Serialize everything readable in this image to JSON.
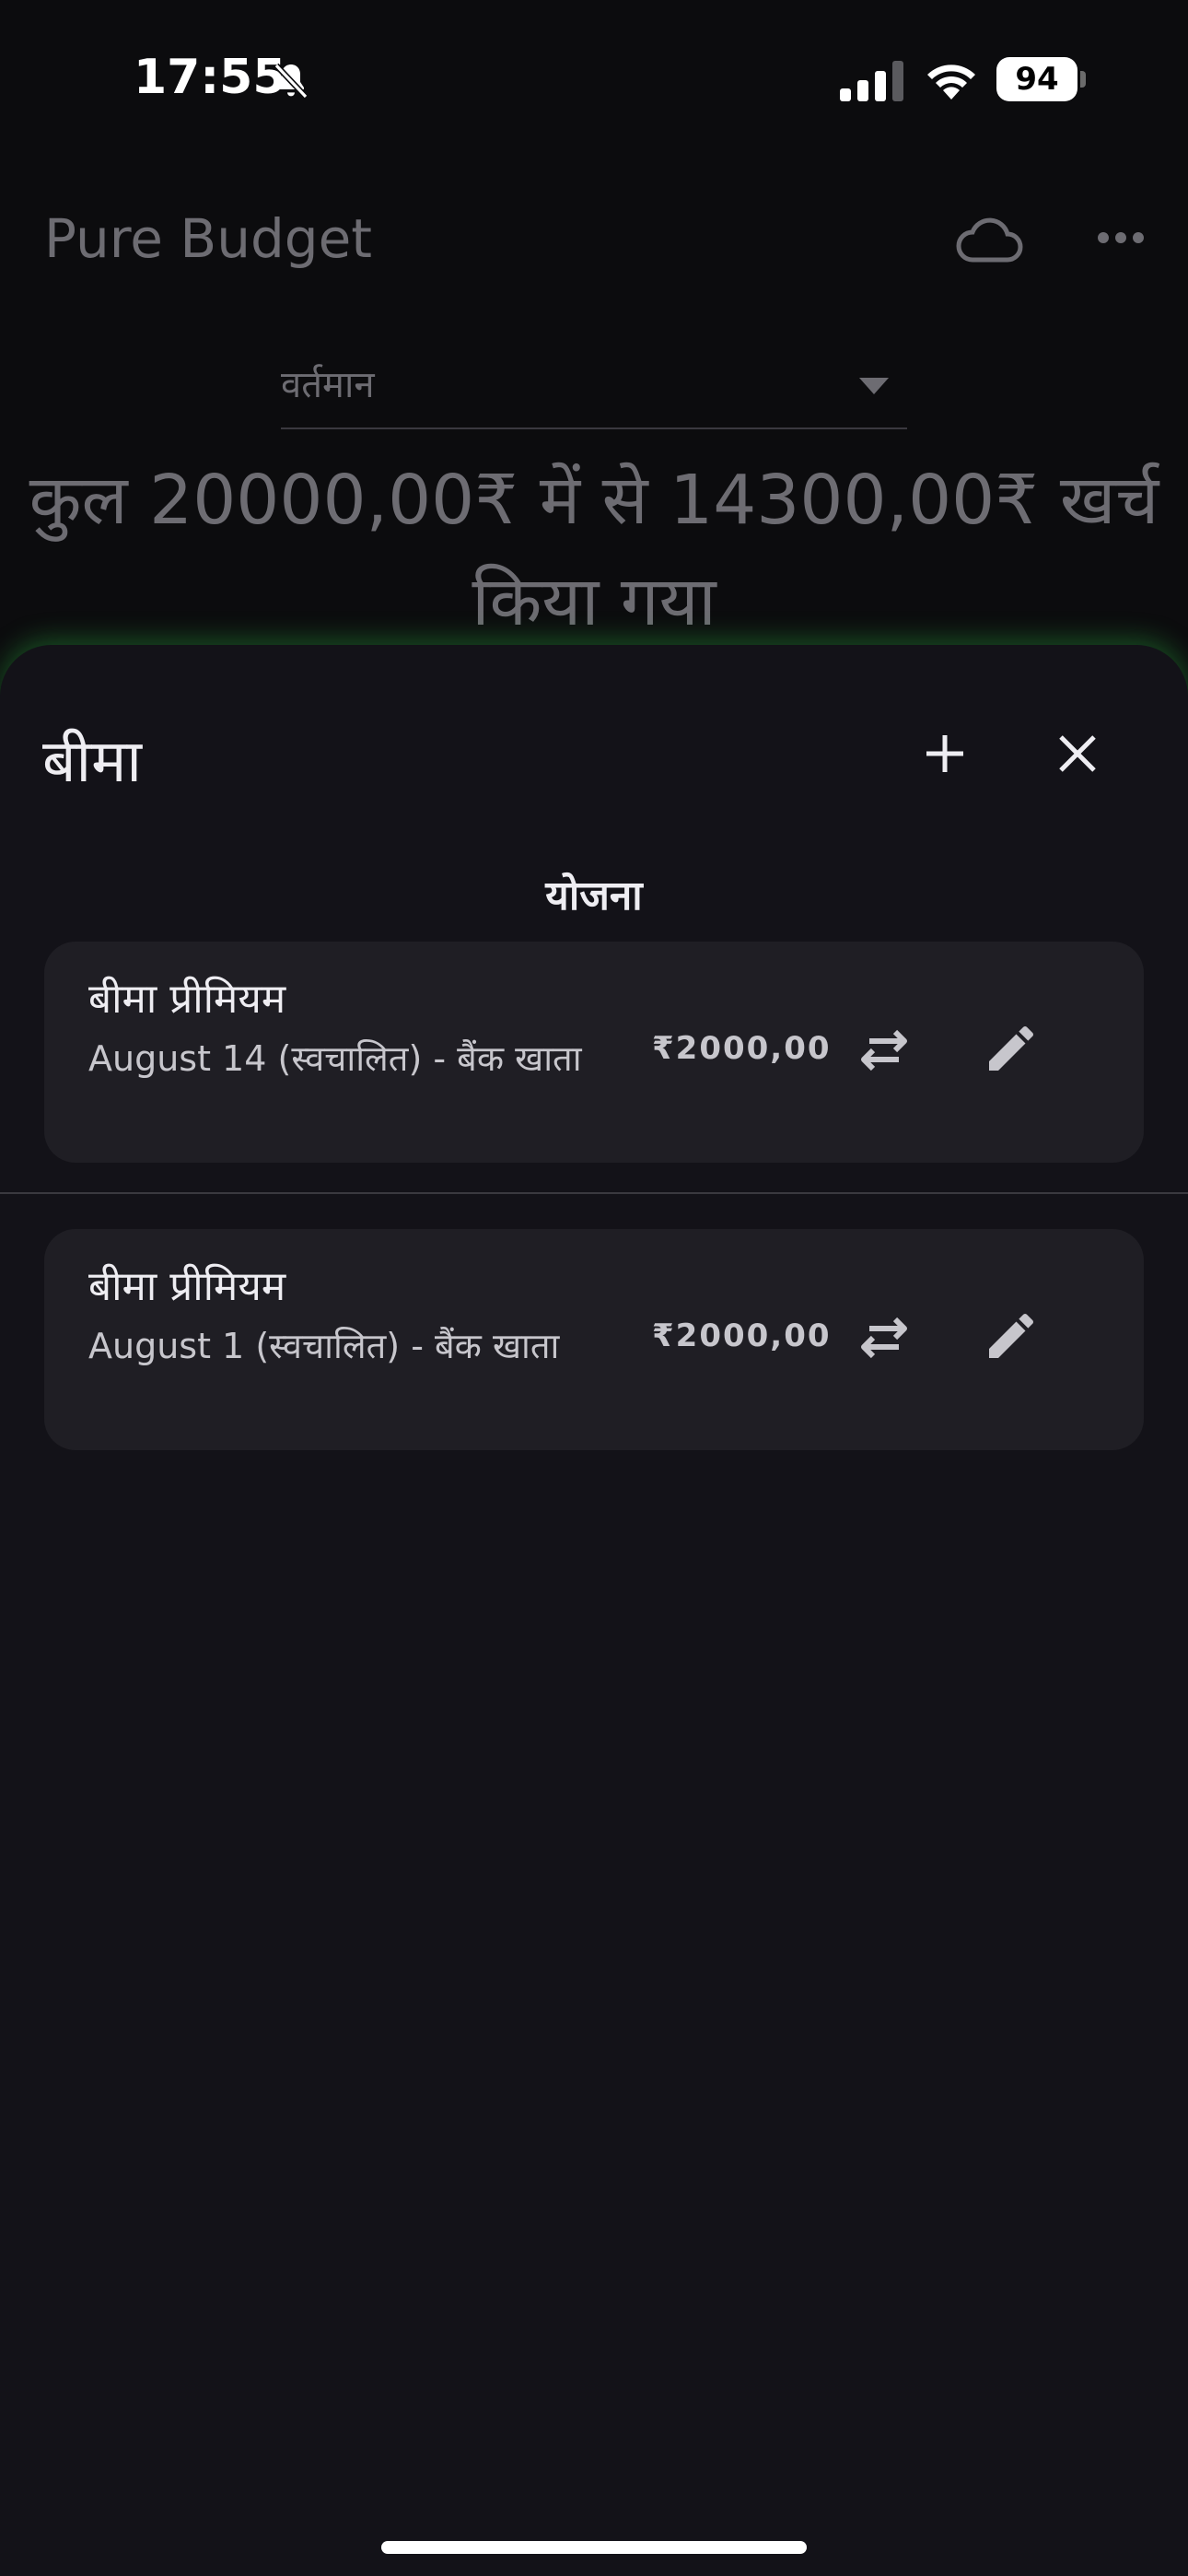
{
  "status_bar": {
    "time": "17:55",
    "battery": "94",
    "icons": [
      "bell-slash-icon",
      "cellular-signal-icon",
      "wifi-icon",
      "battery-icon"
    ]
  },
  "app": {
    "title": "Pure Budget",
    "icons": [
      "cloud-icon",
      "more-icon"
    ],
    "period_select": {
      "value": "वर्तमान",
      "icon": "dropdown-icon"
    },
    "summary_line1": "कुल 20000,00₹ में से 14300,00₹ खर्च",
    "summary_line2": "किया गया"
  },
  "sheet": {
    "title": "बीमा",
    "add_icon": "plus-icon",
    "close_icon": "close-icon",
    "section_heading": "योजना",
    "items": [
      {
        "title": "बीमा प्रीमियम",
        "subtitle": "August 14 (स्वचालित) - बैंक खाता",
        "amount": "₹2000,00",
        "icons": [
          "transfer-icon",
          "edit-icon"
        ]
      },
      {
        "title": "बीमा प्रीमियम",
        "subtitle": "August 1 (स्वचालित) - बैंक खाता",
        "amount": "₹2000,00",
        "icons": [
          "transfer-icon",
          "edit-icon"
        ]
      }
    ]
  },
  "colors": {
    "sheet_background": "#131218",
    "card_background": "#1f1e24",
    "glow": "#28a03c",
    "dimmed_text": "#6d6c72"
  }
}
